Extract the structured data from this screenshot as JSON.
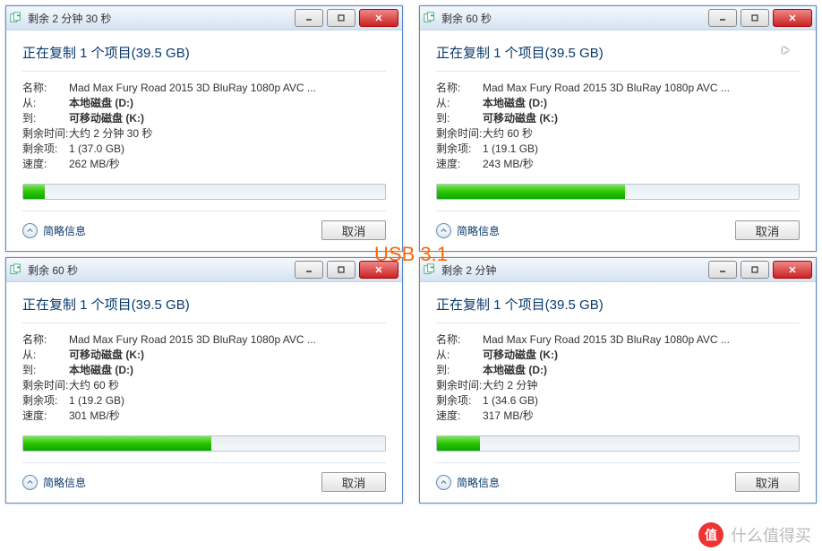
{
  "center_label": "USB 3.1",
  "watermark": "什么值得买",
  "watermark_badge": "值",
  "btn_cancel": "取消",
  "toggle_label": "简略信息",
  "labels": {
    "name": "名称:",
    "from": "从:",
    "to": "到:",
    "time_left": "剩余时间:",
    "items_left": "剩余项:",
    "speed": "速度:"
  },
  "d": [
    {
      "title": "剩余 2 分钟 30 秒",
      "header": "正在复制 1 个项目(39.5 GB)",
      "name": "Mad Max Fury Road 2015 3D BluRay 1080p AVC ...",
      "from": "本地磁盘 (D:)",
      "to": "可移动磁盘 (K:)",
      "time": "大约 2 分钟 30 秒",
      "items": "1 (37.0 GB)",
      "speed": "262 MB/秒",
      "prog": 6
    },
    {
      "title": "剩余 60 秒",
      "header": "正在复制 1 个项目(39.5 GB)",
      "name": "Mad Max Fury Road 2015 3D BluRay 1080p AVC ...",
      "from": "本地磁盘 (D:)",
      "to": "可移动磁盘 (K:)",
      "time": "大约 60 秒",
      "items": "1 (19.1 GB)",
      "speed": "243 MB/秒",
      "prog": 52
    },
    {
      "title": "剩余 60 秒",
      "header": "正在复制 1 个项目(39.5 GB)",
      "name": "Mad Max Fury Road 2015 3D BluRay 1080p AVC ...",
      "from": "可移动磁盘 (K:)",
      "to": "本地磁盘 (D:)",
      "time": "大约 60 秒",
      "items": "1 (19.2 GB)",
      "speed": "301 MB/秒",
      "prog": 52
    },
    {
      "title": "剩余 2 分钟",
      "header": "正在复制 1 个项目(39.5 GB)",
      "name": "Mad Max Fury Road 2015 3D BluRay 1080p AVC ...",
      "from": "可移动磁盘 (K:)",
      "to": "本地磁盘 (D:)",
      "time": "大约 2 分钟",
      "items": "1 (34.6 GB)",
      "speed": "317 MB/秒",
      "prog": 12
    }
  ]
}
